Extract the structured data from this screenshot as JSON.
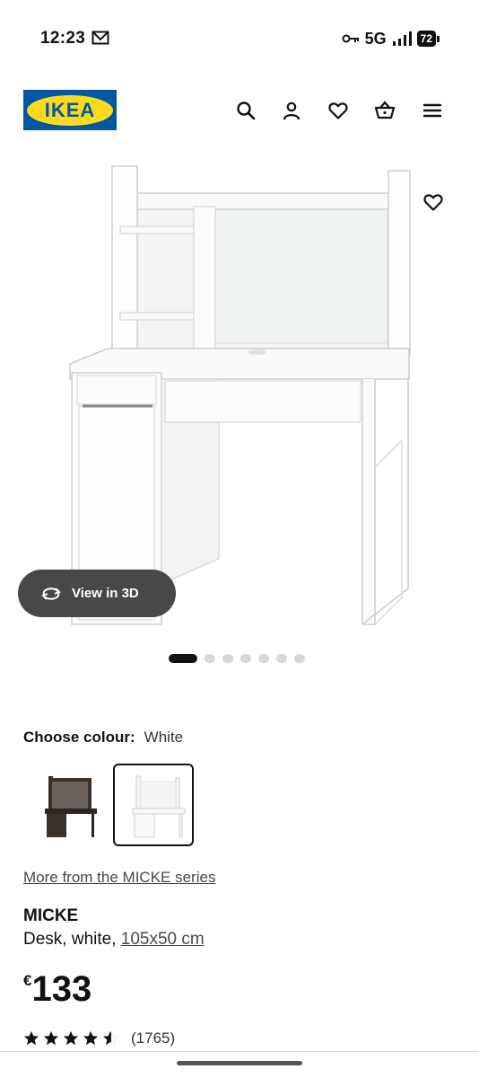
{
  "status_bar": {
    "time": "12:23",
    "network": "5G",
    "battery": "72"
  },
  "header": {
    "logo_text": "IKEA",
    "brand_blue": "#0058a3",
    "brand_yellow": "#ffda1a",
    "icons": [
      "search-icon",
      "account-icon",
      "heart-icon",
      "basket-icon",
      "menu-icon"
    ]
  },
  "gallery": {
    "view_3d_label": "View in 3D",
    "total_images": 7,
    "active_image": 1
  },
  "colour": {
    "label": "Choose colour:",
    "selected": "White",
    "options": [
      "black-brown",
      "white"
    ]
  },
  "series_link": "More from the MICKE series",
  "product": {
    "name": "MICKE",
    "description": "Desk, white, ",
    "size": "105x50 cm",
    "currency": "€",
    "price": "133",
    "rating": 4.5,
    "review_count": "(1765)"
  }
}
